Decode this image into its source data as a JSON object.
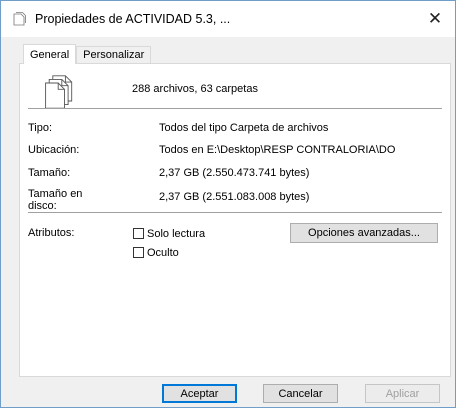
{
  "window": {
    "title": "Propiedades de ACTIVIDAD 5.3, ...",
    "close_symbol": "✕"
  },
  "tabs": [
    {
      "label": "General",
      "active": true
    },
    {
      "label": "Personalizar",
      "active": false
    }
  ],
  "general": {
    "summary": "288 archivos, 63 carpetas",
    "rows": [
      {
        "label": "Tipo:",
        "value": "Todos del tipo Carpeta de archivos"
      },
      {
        "label": "Ubicación:",
        "value": "Todos en E:\\Desktop\\RESP CONTRALORIA\\DO"
      },
      {
        "label": "Tamaño:",
        "value": "2,37 GB (2.550.473.741 bytes)"
      },
      {
        "label": "Tamaño en disco:",
        "value": "2,37 GB (2.551.083.008 bytes)"
      }
    ],
    "attributes": {
      "label": "Atributos:",
      "read_only_label": "Solo lectura",
      "read_only_checked": false,
      "hidden_label": "Oculto",
      "hidden_checked": false,
      "advanced_button": "Opciones avanzadas..."
    }
  },
  "footer": {
    "ok_label": "Aceptar",
    "cancel_label": "Cancelar",
    "apply_label": "Aplicar",
    "apply_enabled": false
  },
  "icons": {
    "title_icon": "files-stack-icon",
    "content_icon": "files-stack-icon"
  }
}
